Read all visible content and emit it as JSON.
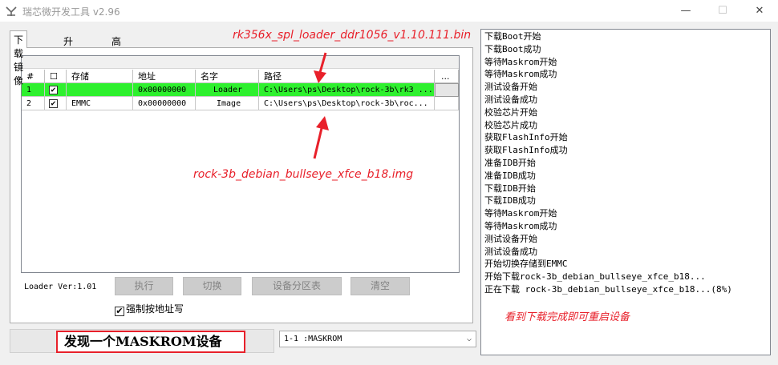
{
  "window": {
    "title": "瑞芯微开发工具 v2.96",
    "min_glyph": "—",
    "max_glyph": "☐",
    "close_glyph": "✕"
  },
  "tabs": [
    {
      "label": "下载镜像",
      "active": true
    },
    {
      "label": "升级固件",
      "active": false
    },
    {
      "label": "高级功能",
      "active": false
    }
  ],
  "table": {
    "headers": [
      "#",
      "☐",
      "存储",
      "地址",
      "名字",
      "路径",
      "..."
    ],
    "rows": [
      {
        "index": "1",
        "checked": "✔",
        "storage": "",
        "address": "0x00000000",
        "name": "Loader",
        "path": "C:\\Users\\ps\\Desktop\\rock-3b\\rk3 ...",
        "selected": true
      },
      {
        "index": "2",
        "checked": "✔",
        "storage": "EMMC",
        "address": "0x00000000",
        "name": "Image",
        "path": "C:\\Users\\ps\\Desktop\\rock-3b\\roc...",
        "selected": false
      }
    ]
  },
  "annotations": {
    "loader_file": "rk356x_spl_loader_ddr1056_v1.10.111.bin",
    "image_file": "rock-3b_debian_bullseye_xfce_b18.img",
    "restart_hint": "看到下载完成即可重启设备"
  },
  "controls": {
    "loader_version": "Loader Ver:1.01",
    "execute": "执行",
    "switch": "切换",
    "partition_table": "设备分区表",
    "clear": "清空",
    "force_address": "强制按地址写",
    "force_checked": "✔"
  },
  "status": {
    "message": "发现一个MASKROM设备",
    "device": "1-1 :MASKROM"
  },
  "log": [
    "下载Boot开始",
    "下载Boot成功",
    "等待Maskrom开始",
    "等待Maskrom成功",
    "测试设备开始",
    "测试设备成功",
    "校验芯片开始",
    "校验芯片成功",
    "获取FlashInfo开始",
    "获取FlashInfo成功",
    "准备IDB开始",
    "准备IDB成功",
    "下载IDB开始",
    "下载IDB成功",
    "等待Maskrom开始",
    "等待Maskrom成功",
    "测试设备开始",
    "测试设备成功",
    "开始切换存储到EMMC",
    "开始下载rock-3b_debian_bullseye_xfce_b18...",
    "正在下载 rock-3b_debian_bullseye_xfce_b18...(8%)"
  ],
  "colors": {
    "selected_row": "#2ef02e",
    "annotation": "#e8202a"
  }
}
